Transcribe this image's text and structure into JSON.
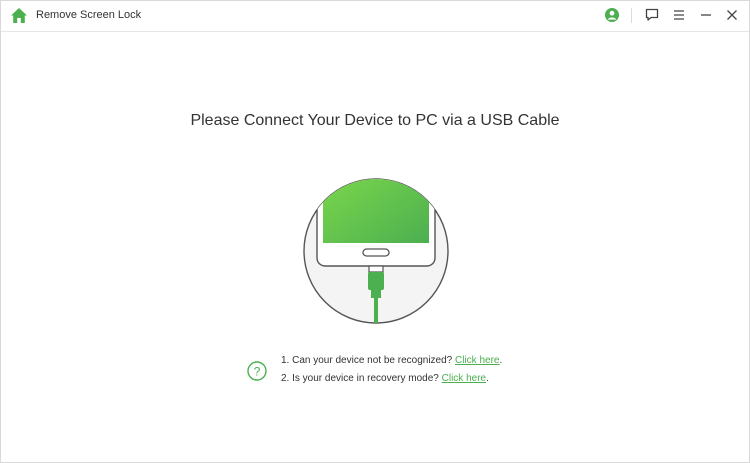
{
  "app": {
    "title": "Remove Screen Lock",
    "accent_color": "#4caf50"
  },
  "titlebar": {
    "icons": [
      "home-icon",
      "account-icon",
      "feedback-icon",
      "menu-icon",
      "minimize-icon",
      "close-icon"
    ]
  },
  "main": {
    "heading": "Please Connect Your Device to PC via a USB Cable",
    "illustration": "phone-usb-cable-illustration"
  },
  "help": {
    "icon": "question-circle-icon",
    "items": [
      {
        "text": "1. Can your device not be recognized? ",
        "link": "Click here",
        "suffix": "."
      },
      {
        "text": "2. Is your device in recovery mode? ",
        "link": "Click here",
        "suffix": "."
      }
    ]
  }
}
